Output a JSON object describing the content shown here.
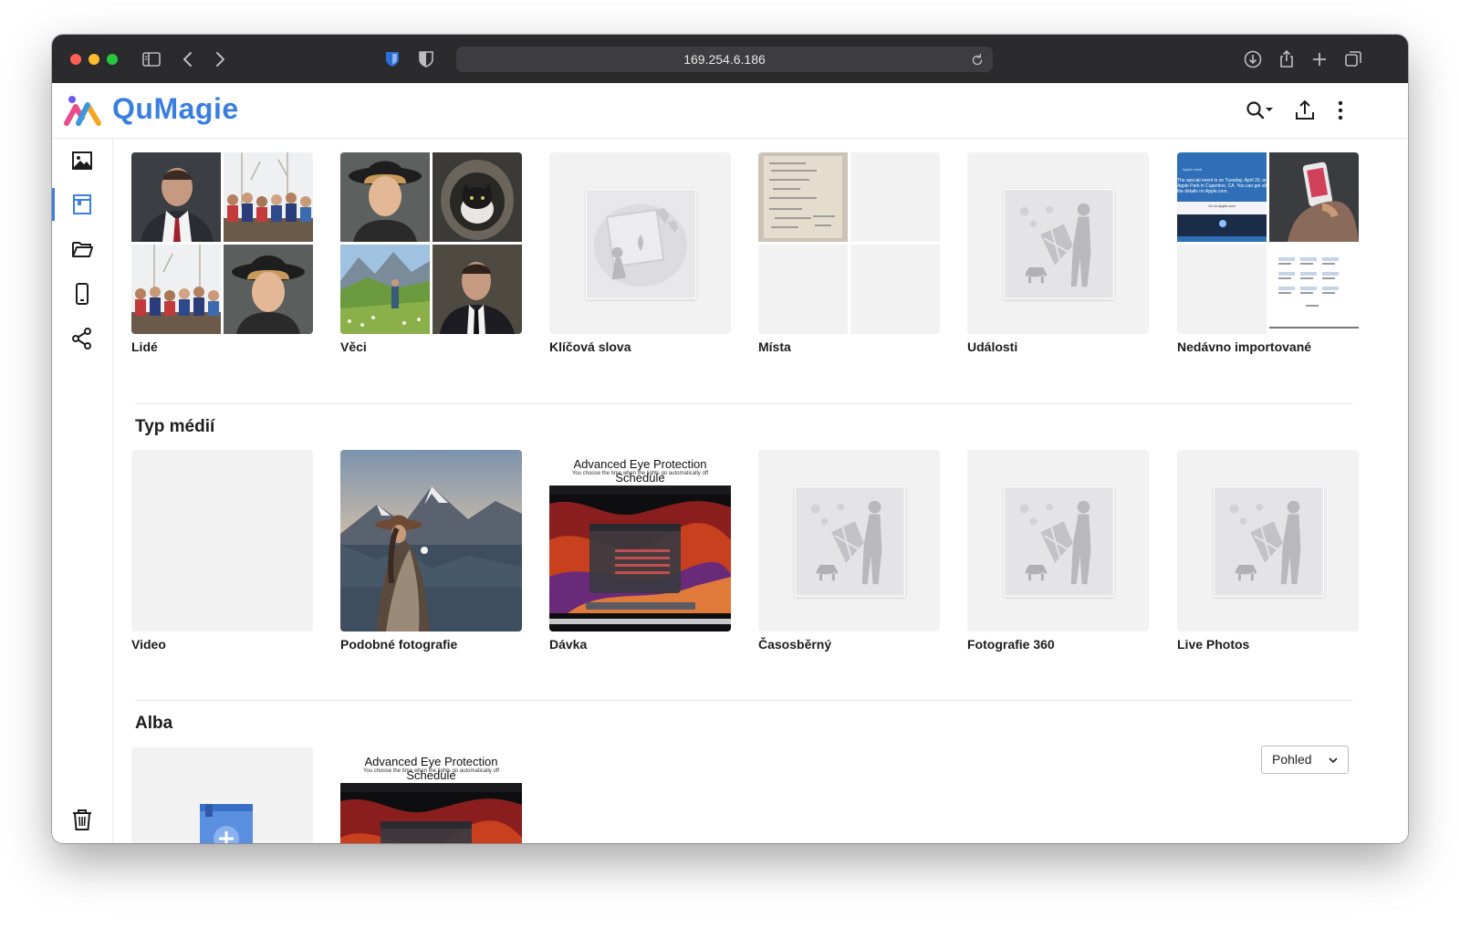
{
  "browser": {
    "url": "169.254.6.186"
  },
  "app": {
    "name": "QuMagie"
  },
  "sidebar": {
    "items": [
      {
        "name": "photos-icon"
      },
      {
        "name": "album-icon"
      },
      {
        "name": "folder-icon"
      },
      {
        "name": "device-icon"
      },
      {
        "name": "share-icon"
      }
    ],
    "trash": "trash-icon"
  },
  "smart_albums": {
    "items": [
      {
        "label": "Lidé"
      },
      {
        "label": "Věci"
      },
      {
        "label": "Klíčová slova"
      },
      {
        "label": "Místa"
      },
      {
        "label": "Události"
      },
      {
        "label": "Nedávno importované"
      }
    ]
  },
  "media_types": {
    "title": "Typ médií",
    "items": [
      {
        "label": "Video"
      },
      {
        "label": "Podobné fotografie"
      },
      {
        "label": "Dávka"
      },
      {
        "label": "Časosběrný"
      },
      {
        "label": "Fotografie 360"
      },
      {
        "label": "Live Photos"
      }
    ]
  },
  "albums": {
    "title": "Alba",
    "view_label": "Pohled"
  },
  "thumbnails": {
    "screenshot_title": "Advanced Eye Protection Schedule",
    "screenshot_subtitle": "You choose the time when the lights go automatically off",
    "apple_event_small": "Apple event",
    "apple_event_text": "The special event is on Tuesday, April 20, at Apple Park in Cupertino, CA. You can get all the details on Apple.com.",
    "apple_event_link": "Go to Apple.com"
  },
  "colors": {
    "accent": "#3a7fe0",
    "titlebar": "#2b2a2d",
    "tile_bg": "#f2f2f2"
  }
}
